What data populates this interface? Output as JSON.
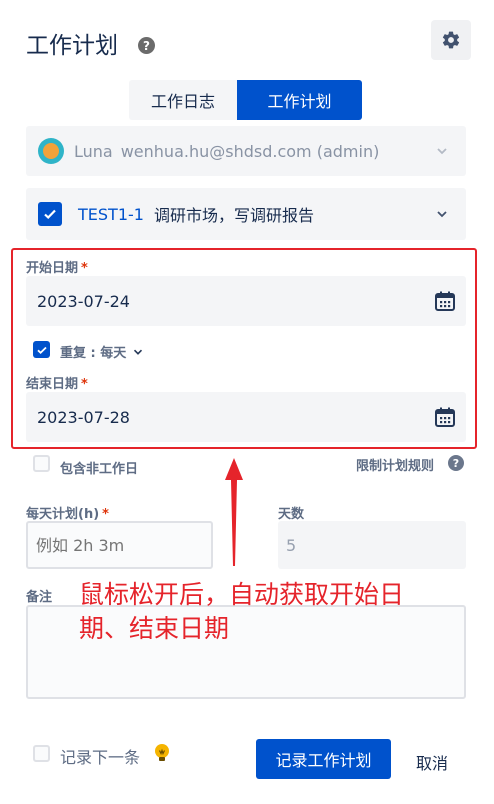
{
  "header": {
    "title": "工作计划",
    "help_glyph": "?"
  },
  "tabs": [
    {
      "label": "工作日志",
      "active": false
    },
    {
      "label": "工作计划",
      "active": true
    }
  ],
  "user": {
    "name": "Luna",
    "email": "wenhua.hu@shdsd.com (admin)"
  },
  "issue": {
    "key": "TEST1-1",
    "summary": "调研市场，写调研报告"
  },
  "start_date": {
    "label": "开始日期",
    "required_mark": "*",
    "value": "2023-07-24"
  },
  "repeat": {
    "label": "重复 : 每天",
    "checked": true
  },
  "end_date": {
    "label": "结束日期",
    "required_mark": "*",
    "value": "2023-07-28"
  },
  "include_nonworking": {
    "label": "包含非工作日",
    "checked": false
  },
  "limit_rules": {
    "label": "限制计划规则",
    "help_glyph": "?"
  },
  "daily_plan": {
    "label": "每天计划(h)",
    "required_mark": "*",
    "placeholder": "例如 2h 3m"
  },
  "days": {
    "label": "天数",
    "value": "5"
  },
  "note": {
    "label": "备注"
  },
  "annotation": {
    "line1": "鼠标松开后，自动获取开始日",
    "line2": "期、结束日期"
  },
  "footer": {
    "log_next_label": "记录下一条",
    "submit_label": "记录工作计划",
    "cancel_label": "取消"
  },
  "colors": {
    "primary": "#0052cc",
    "annotation_red": "#e5242b",
    "required_red": "#de350b"
  }
}
